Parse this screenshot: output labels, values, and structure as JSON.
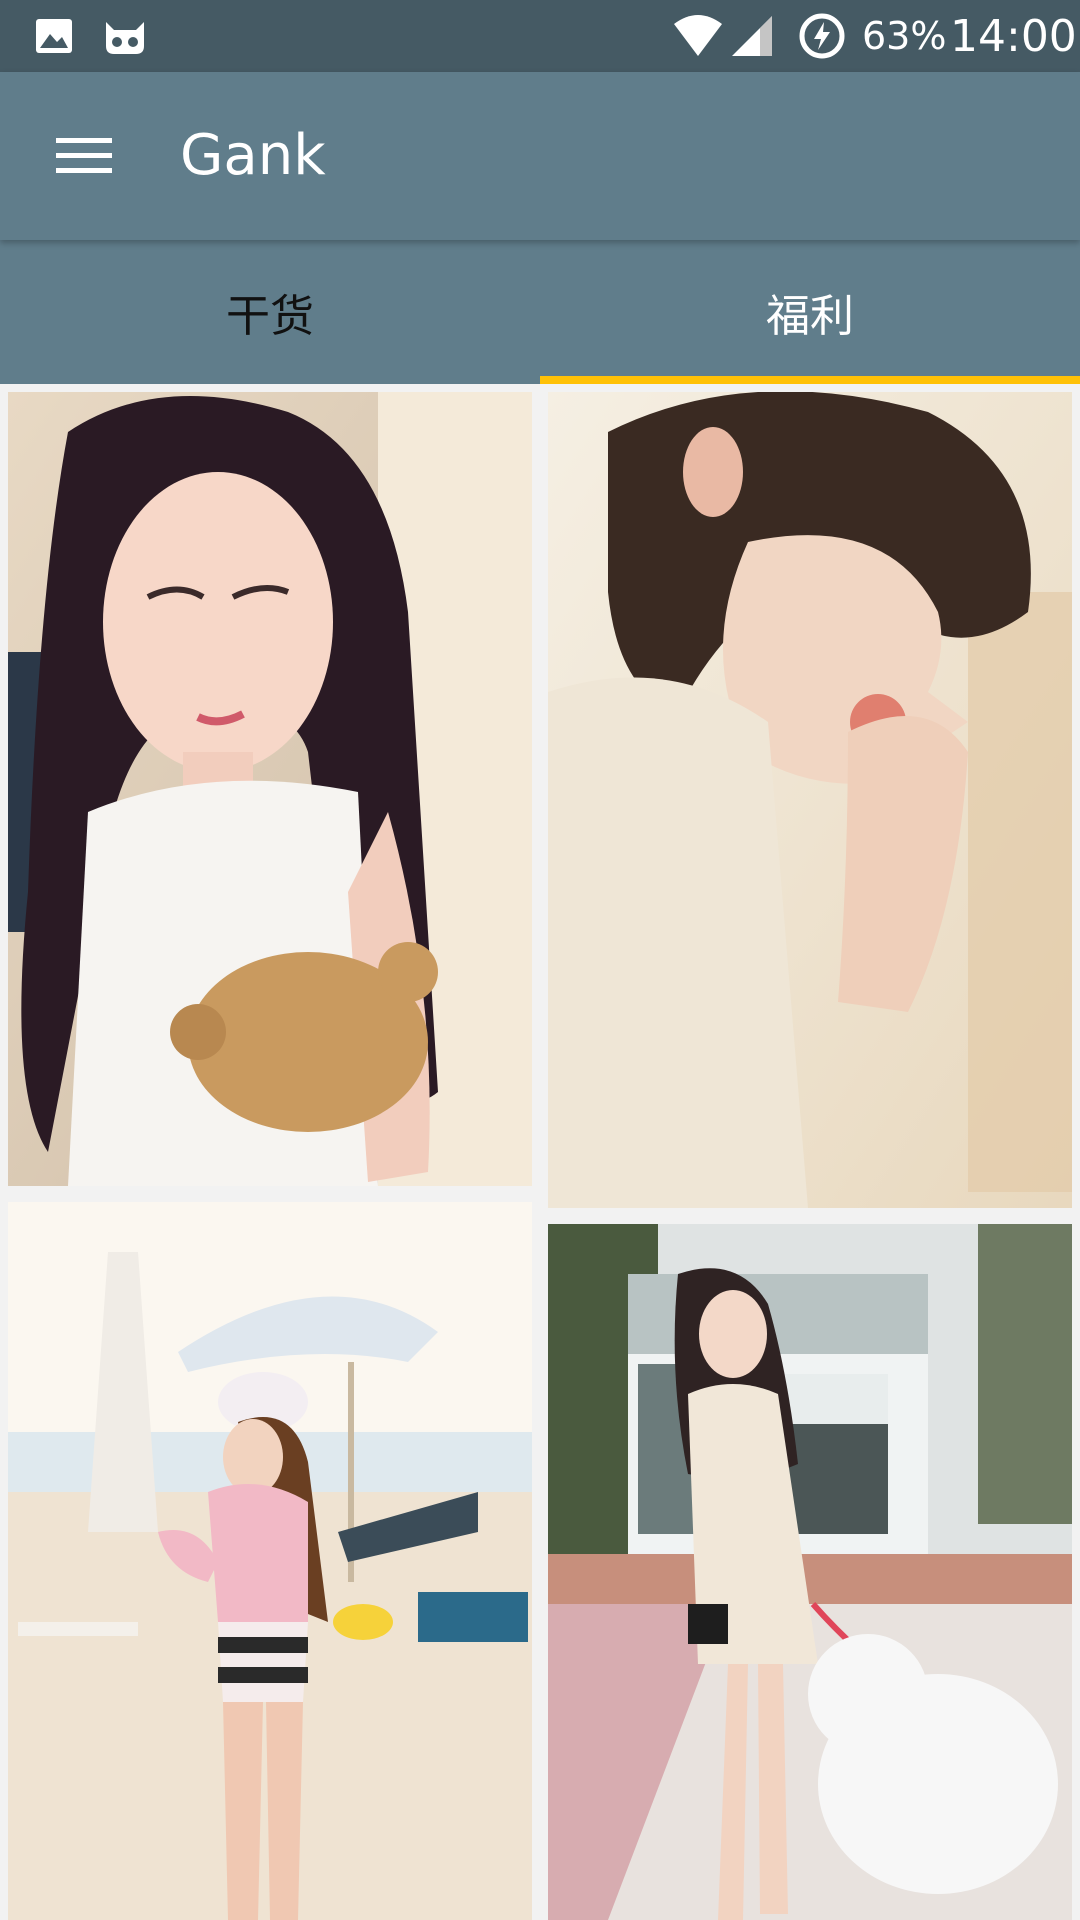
{
  "status_bar": {
    "battery_percent": "63%",
    "time": "14:00",
    "icons": [
      "image-icon",
      "cat-icon",
      "wifi-icon",
      "signal-icon",
      "battery-charging-icon"
    ]
  },
  "toolbar": {
    "title": "Gank",
    "menu_icon": "menu-icon"
  },
  "tabs": [
    {
      "label": "干货",
      "selected": false
    },
    {
      "label": "福利",
      "selected": true
    }
  ],
  "colors": {
    "status_bar": "#455a64",
    "primary": "#607d8b",
    "accent": "#ffc107"
  },
  "photos": [
    {
      "name": "photo-1",
      "description": "girl with teddy bear"
    },
    {
      "name": "photo-2",
      "description": "girl eating candy"
    },
    {
      "name": "photo-3",
      "description": "girl on beach with skateboard"
    },
    {
      "name": "photo-4",
      "description": "girl with white dog"
    }
  ]
}
